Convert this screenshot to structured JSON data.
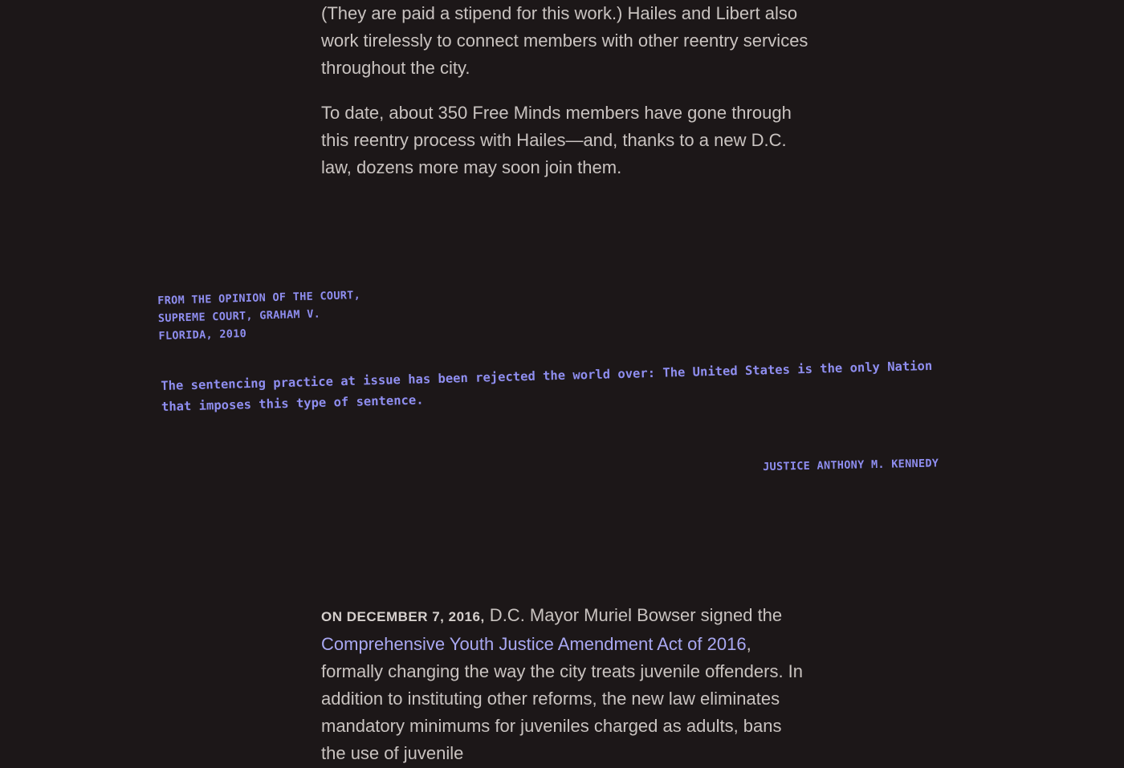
{
  "article": {
    "para_continued": "(They are paid a stipend for this work.) Hailes and Libert also work tirelessly to connect members with other reentry services throughout the city.",
    "para_date": "To date, about 350 Free Minds members have gone through this reentry process with Hailes—and, thanks to a new D.C. law, dozens more may soon join them.",
    "para_law": {
      "lead_in": "On December 7, 2016,",
      "before_link": " D.C. Mayor Muriel Bowser signed the ",
      "link_text": "Comprehensive Youth Justice Amendment Act of 2016",
      "after_link": ", formally changing the way the city treats juvenile offenders. In addition to instituting other reforms, the new law eliminates mandatory minimums for juveniles charged as adults, bans the use of juvenile"
    }
  },
  "pull_quote": {
    "source": "From the opinion of the Court, Supreme Court, Graham v. Florida, 2010",
    "quote": "The sentencing practice at issue has been rejected the world over: The United States is the only Nation that imposes this type of sentence.",
    "attribution": "Justice Anthony M. Kennedy"
  },
  "colors": {
    "background": "#1c1718",
    "body_text": "#c9c3c0",
    "typewriter_accent": "#8f8ef0",
    "link": "#a9a8f2"
  }
}
